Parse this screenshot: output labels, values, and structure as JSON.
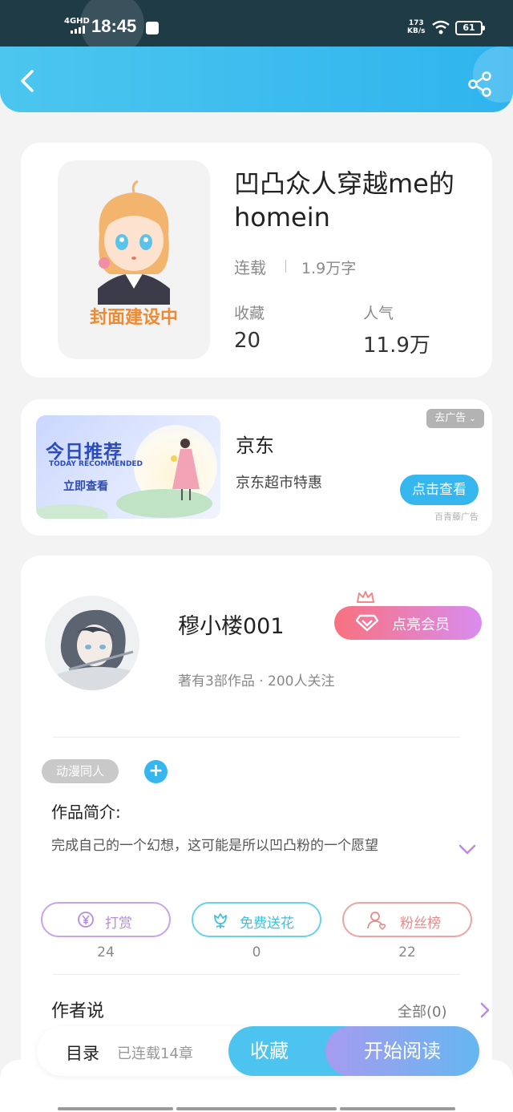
{
  "status_bar": {
    "network": "4GHD",
    "time": "18:45",
    "speed_value": "173",
    "speed_unit": "KB/s",
    "battery": "61"
  },
  "header": {
    "back_icon": "chevron-left-icon",
    "share_icon": "share-icon"
  },
  "book": {
    "title": "凹凸众人穿越me的homein",
    "cover_text": "封面建设中",
    "status": "连载",
    "word_count": "1.9万字",
    "favorites_label": "收藏",
    "favorites_value": "20",
    "popularity_label": "人气",
    "popularity_value": "11.9万"
  },
  "ad": {
    "banner_title": "今日推荐",
    "banner_subtitle": "TODAY RECOMMENDED",
    "banner_cta": "立即查看",
    "brand": "京东",
    "description": "京东超市特惠",
    "remove_label": "去广告",
    "button_label": "点击查看",
    "source": "百青藤广告"
  },
  "author": {
    "name": "穆小楼001",
    "meta": "著有3部作品 · 200人关注",
    "vip_label": "点亮会员"
  },
  "work": {
    "tag": "动漫同人",
    "intro_title": "作品简介:",
    "intro_text": "完成自己的一个幻想，这可能是所以凹凸粉的一个愿望",
    "actions": [
      {
        "label": "打赏",
        "count": "24",
        "icon": "yen-icon",
        "color": "#b98be0"
      },
      {
        "label": "免费送花",
        "count": "0",
        "icon": "flower-icon",
        "color": "#4cc9e3"
      },
      {
        "label": "粉丝榜",
        "count": "22",
        "icon": "user-icon",
        "color": "#e88a8a"
      }
    ],
    "author_says_title": "作者说",
    "author_says_all": "全部(0)"
  },
  "bottom_bar": {
    "toc_label": "目录",
    "chapters": "已连载14章",
    "favorite_label": "收藏",
    "read_label": "开始阅读"
  }
}
